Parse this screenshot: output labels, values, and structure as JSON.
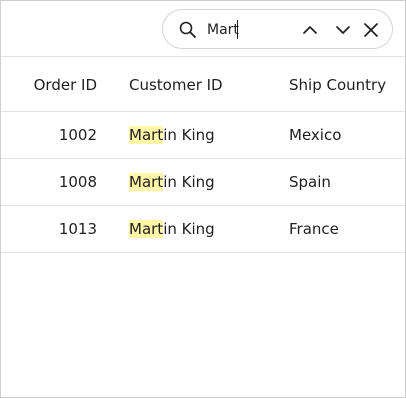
{
  "search": {
    "value": "Mart",
    "highlight_color": "#fff6a8"
  },
  "columns": {
    "order_id": "Order ID",
    "customer_id": "Customer ID",
    "ship_country": "Ship Country"
  },
  "rows": [
    {
      "order_id": "1002",
      "customer_match": "Mart",
      "customer_rest": "in King",
      "ship_country": "Mexico"
    },
    {
      "order_id": "1008",
      "customer_match": "Mart",
      "customer_rest": "in King",
      "ship_country": "Spain"
    },
    {
      "order_id": "1013",
      "customer_match": "Mart",
      "customer_rest": "in King",
      "ship_country": "France"
    }
  ],
  "icons": {
    "search": "search-icon",
    "previous": "chevron-up-icon",
    "next": "chevron-down-icon",
    "close": "close-icon"
  }
}
